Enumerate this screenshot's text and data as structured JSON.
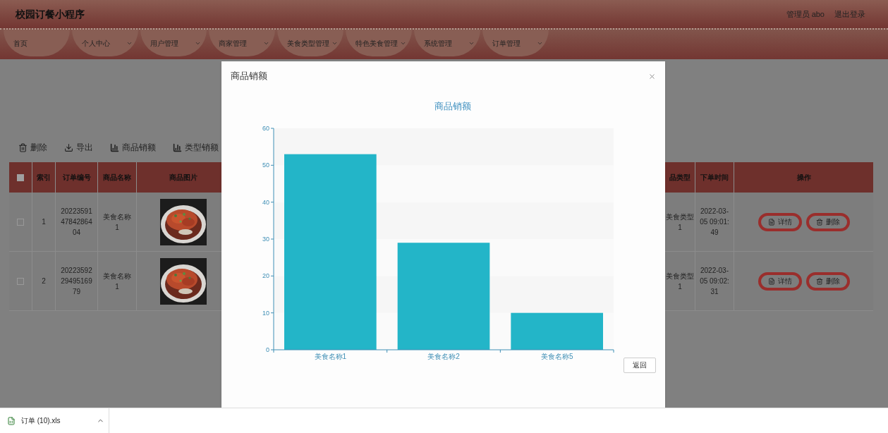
{
  "header": {
    "title": "校园订餐小程序",
    "user": "管理员 abo",
    "logout": "退出登录"
  },
  "nav": [
    {
      "label": "首页",
      "dropdown": false
    },
    {
      "label": "个人中心",
      "dropdown": true
    },
    {
      "label": "用户管理",
      "dropdown": true
    },
    {
      "label": "商家管理",
      "dropdown": true
    },
    {
      "label": "美食类型管理",
      "dropdown": true
    },
    {
      "label": "特色美食管理",
      "dropdown": true
    },
    {
      "label": "系统管理",
      "dropdown": true
    },
    {
      "label": "订单管理",
      "dropdown": true
    }
  ],
  "toolbar": [
    {
      "label": "删除",
      "kind": "delete"
    },
    {
      "label": "导出",
      "kind": "export"
    },
    {
      "label": "商品销额",
      "kind": "chart"
    },
    {
      "label": "类型销额",
      "kind": "chart"
    }
  ],
  "table": {
    "select_all": {
      "checked": false
    },
    "columns": [
      "索引",
      "订单编号",
      "商品名称",
      "商品图片",
      "品类型",
      "下单时间",
      "操作"
    ],
    "rows": [
      {
        "checked": false,
        "index": "1",
        "order_no": "202235914784286404",
        "name": "美食名称1",
        "picture": {
          "kind": "picture"
        },
        "type": "美食类型1",
        "time": "2022-03-05 09:01:49",
        "actions": [
          "详情",
          "删除"
        ]
      },
      {
        "checked": false,
        "index": "2",
        "order_no": "202235922949516979",
        "name": "美食名称1",
        "picture": {
          "kind": "picture"
        },
        "type": "美食类型1",
        "time": "2022-03-05 09:02:31",
        "actions": [
          "详情",
          "删除"
        ]
      }
    ]
  },
  "dialog": {
    "title": "商品销额",
    "chart_data": {
      "type": "bar",
      "title": "商品销额",
      "categories": [
        "美食名称1",
        "美食名称2",
        "美食名称5"
      ],
      "values": [
        53,
        29,
        10
      ],
      "ylim": [
        0,
        60
      ],
      "yticks": [
        0,
        10,
        20,
        30,
        40,
        50,
        60
      ]
    },
    "button": "返回"
  },
  "download_bar": {
    "file": "订单 (10).xls"
  }
}
